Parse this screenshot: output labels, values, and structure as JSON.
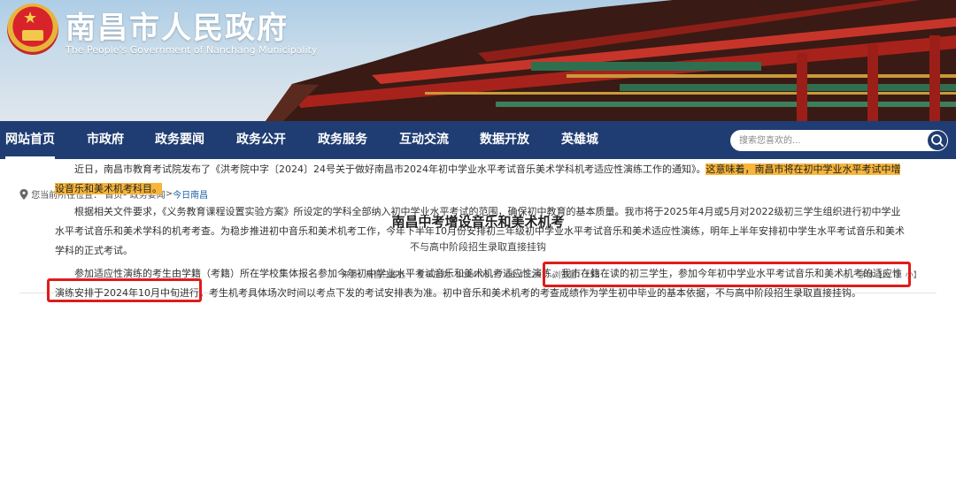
{
  "header": {
    "title": "南昌市人民政府",
    "subtitle": "The People's Government of Nanchang Municipality"
  },
  "nav": {
    "items": [
      "网站首页",
      "市政府",
      "政务要闻",
      "政务公开",
      "政务服务",
      "互动交流",
      "数据开放",
      "英雄城"
    ],
    "active_index": 0
  },
  "search": {
    "placeholder": "搜索您喜欢的..."
  },
  "breadcrumb": {
    "prefix": "您当前所在位置：",
    "items": [
      "首页",
      "政务要闻",
      "今日南昌"
    ],
    "separator": ">"
  },
  "article": {
    "title": "南昌中考增设音乐和美术机考",
    "subtitle": "不与高中阶段招生录取直接挂钩",
    "meta": {
      "source": "来源：南昌日报社",
      "date": "发布日期：2024-08-17 08:43:29",
      "views": "浏览量：753"
    },
    "font_size": {
      "label": "字体【",
      "large": "大",
      "medium": "中",
      "small": "小】"
    },
    "paragraphs": [
      {
        "text": "近日，南昌市教育考试院发布了《洪考院中字〔2024〕24号关于做好南昌市2024年初中学业水平考试音乐美术学科机考适应性演练工作的通知》。",
        "highlight": "这意味着，南昌市将在初中学业水平考试中增设音乐和美术机考科目。"
      },
      {
        "text": "根据相关文件要求，《义务教育课程设置实验方案》所设定的学科全部纳入初中学业水平考试的范围，确保初中教育的基本质量。我市将于2025年4月或5月对2022级初三学生组织进行初中学业水平考试音乐和美术学科的机考考查。为稳步推进初中音乐和美术机考工作，今年下半年10月份安排初三年级初中学业水平考试音乐和美术适应性演练，明年上半年安排初中学生水平考试音乐和美术学科的正式考试。"
      },
      {
        "text": "参加适应性演练的考生由学籍（考籍）所在学校集体报名参加今年初中学业水平考试音乐和美术机考适应性演练。我市在籍在读的初三学生，参加今年初中学业水平考试音乐和美术机考的适应性演练安排于2024年10月中旬进行。考生机考具体场次时间以考点下发的考试安排表为准。初中音乐和美术机考的考查成绩作为学生初中毕业的基本依据，不与高中阶段招生录取直接挂钩。"
      }
    ]
  },
  "colors": {
    "nav_bg": "#1f3d72",
    "highlight": "#f7b53a",
    "annotation_box": "#e11b1b"
  }
}
